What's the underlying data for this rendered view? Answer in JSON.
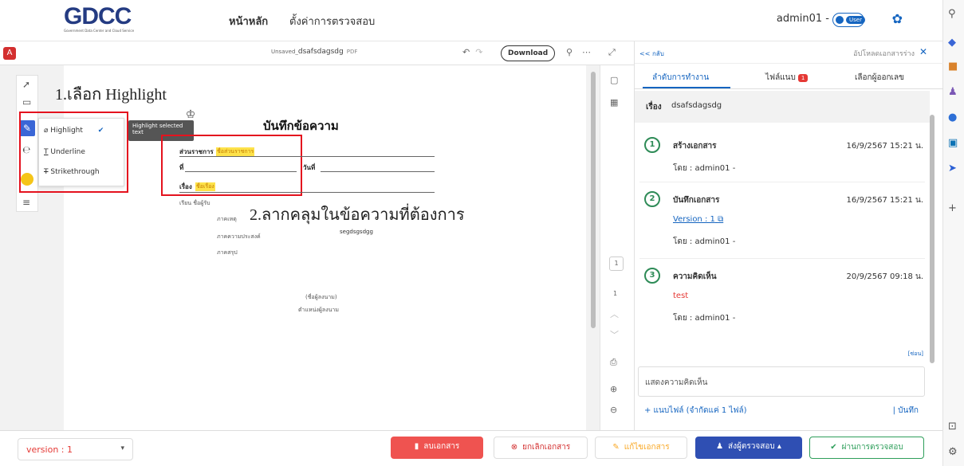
{
  "header": {
    "logo_text": "GDCC",
    "logo_subtext": "Government Data Center and Cloud Service",
    "nav": [
      "หน้าหลัก",
      "ตั้งค่าการตรวจสอบ"
    ],
    "username": "admin01 -",
    "role_toggle": "User",
    "accent_color": "#1565c0"
  },
  "pdf_toolbar": {
    "unsaved_label": "Unsaved_",
    "file_name": "dsafsdagsdg",
    "file_type": "PDF",
    "download_label": "Download"
  },
  "annotations": {
    "step1": "1.เลือก Highlight",
    "step2": "2.ลากคลุมในข้อความที่ต้องการ"
  },
  "highlight_menu": {
    "items": [
      "Highlight",
      "Underline",
      "Strikethrough"
    ],
    "selected": "Highlight",
    "tooltip": "Highlight selected text"
  },
  "document": {
    "title": "บันทึกข้อความ",
    "field_agency": "ส่วนราชการ",
    "field_agency_value": "ชื่อส่วนราชการ",
    "field_ref": "ที่",
    "field_date": "วันที่",
    "field_subject": "เรื่อง",
    "field_subject_value": "ชื่อเรื่อง",
    "to_line": "เรียน ชื่อผู้รับ",
    "section1": "ภาคเหตุ",
    "section2": "ภาคความประสงค์",
    "section2_value": "segdsgsdgg",
    "section3": "ภาคสรุป",
    "signer_name": "(ชื่อผู้ลงนาม)",
    "signer_position": "ตำแหน่งผู้ลงนาม"
  },
  "page_nav": {
    "page_number": "1",
    "total_pages": "1"
  },
  "right_panel": {
    "back_label": "<< กลับ",
    "upload_label": "อัปโหลดเอกสารร่าง",
    "tabs": [
      "ลำดับการทำงาน",
      "ไฟล์แนบ",
      "เลือกผู้ออกเลข"
    ],
    "attachment_count": "1",
    "subject_label": "เรื่อง",
    "subject_value": "dsafsdagsdg",
    "steps": [
      {
        "num": "1",
        "title": "สร้างเอกสาร",
        "date": "16/9/2567 15:21 น.",
        "by": "โดย : admin01 -"
      },
      {
        "num": "2",
        "title": "บันทึกเอกสาร",
        "date": "16/9/2567 15:21 น.",
        "link": "Version : 1",
        "by": "โดย : admin01 -"
      },
      {
        "num": "3",
        "title": "ความคิดเห็น",
        "date": "20/9/2567 09:18 น.",
        "comment": "test",
        "by": "โดย : admin01 -"
      }
    ],
    "more_label": "[ซ่อน]",
    "comment_placeholder": "แสดงความคิดเห็น",
    "attach_label": "+ แนบไฟล์ (จำกัดแค่ 1 ไฟล์)",
    "save_label": "| บันทึก"
  },
  "bottom_bar": {
    "version_select": "version : 1",
    "delete_label": "ลบเอกสาร",
    "cancel_label": "ยกเลิกเอกสาร",
    "edit_label": "แก้ไขเอกสาร",
    "send_label": "ส่งผู้ตรวจสอบ",
    "approve_label": "ผ่านการตรวจสอบ"
  }
}
